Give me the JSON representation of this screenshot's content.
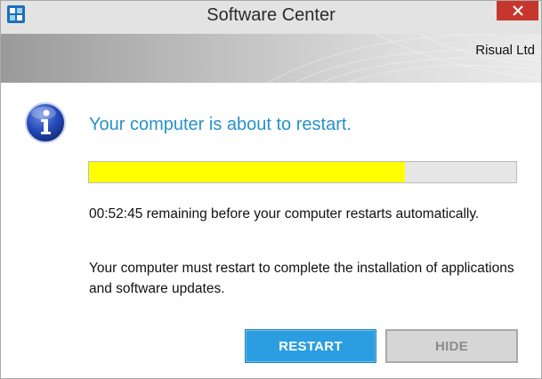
{
  "window": {
    "title": "Software Center",
    "organization": "Risual Ltd"
  },
  "icons": {
    "app": "software-center-icon",
    "close": "close-icon",
    "info": "info-icon"
  },
  "message": {
    "headline": "Your computer is about to restart.",
    "countdown_text": "00:52:45 remaining before your computer restarts automatically.",
    "detail_text": "Your computer must restart to complete the installation of applications and software updates."
  },
  "progress": {
    "fraction": 0.74,
    "fill_color": "#ffff00"
  },
  "buttons": {
    "restart_label": "RESTART",
    "hide_label": "HIDE"
  },
  "colors": {
    "accent": "#2792c8",
    "primary_button": "#2a9ee0",
    "close_button": "#c7362c"
  }
}
